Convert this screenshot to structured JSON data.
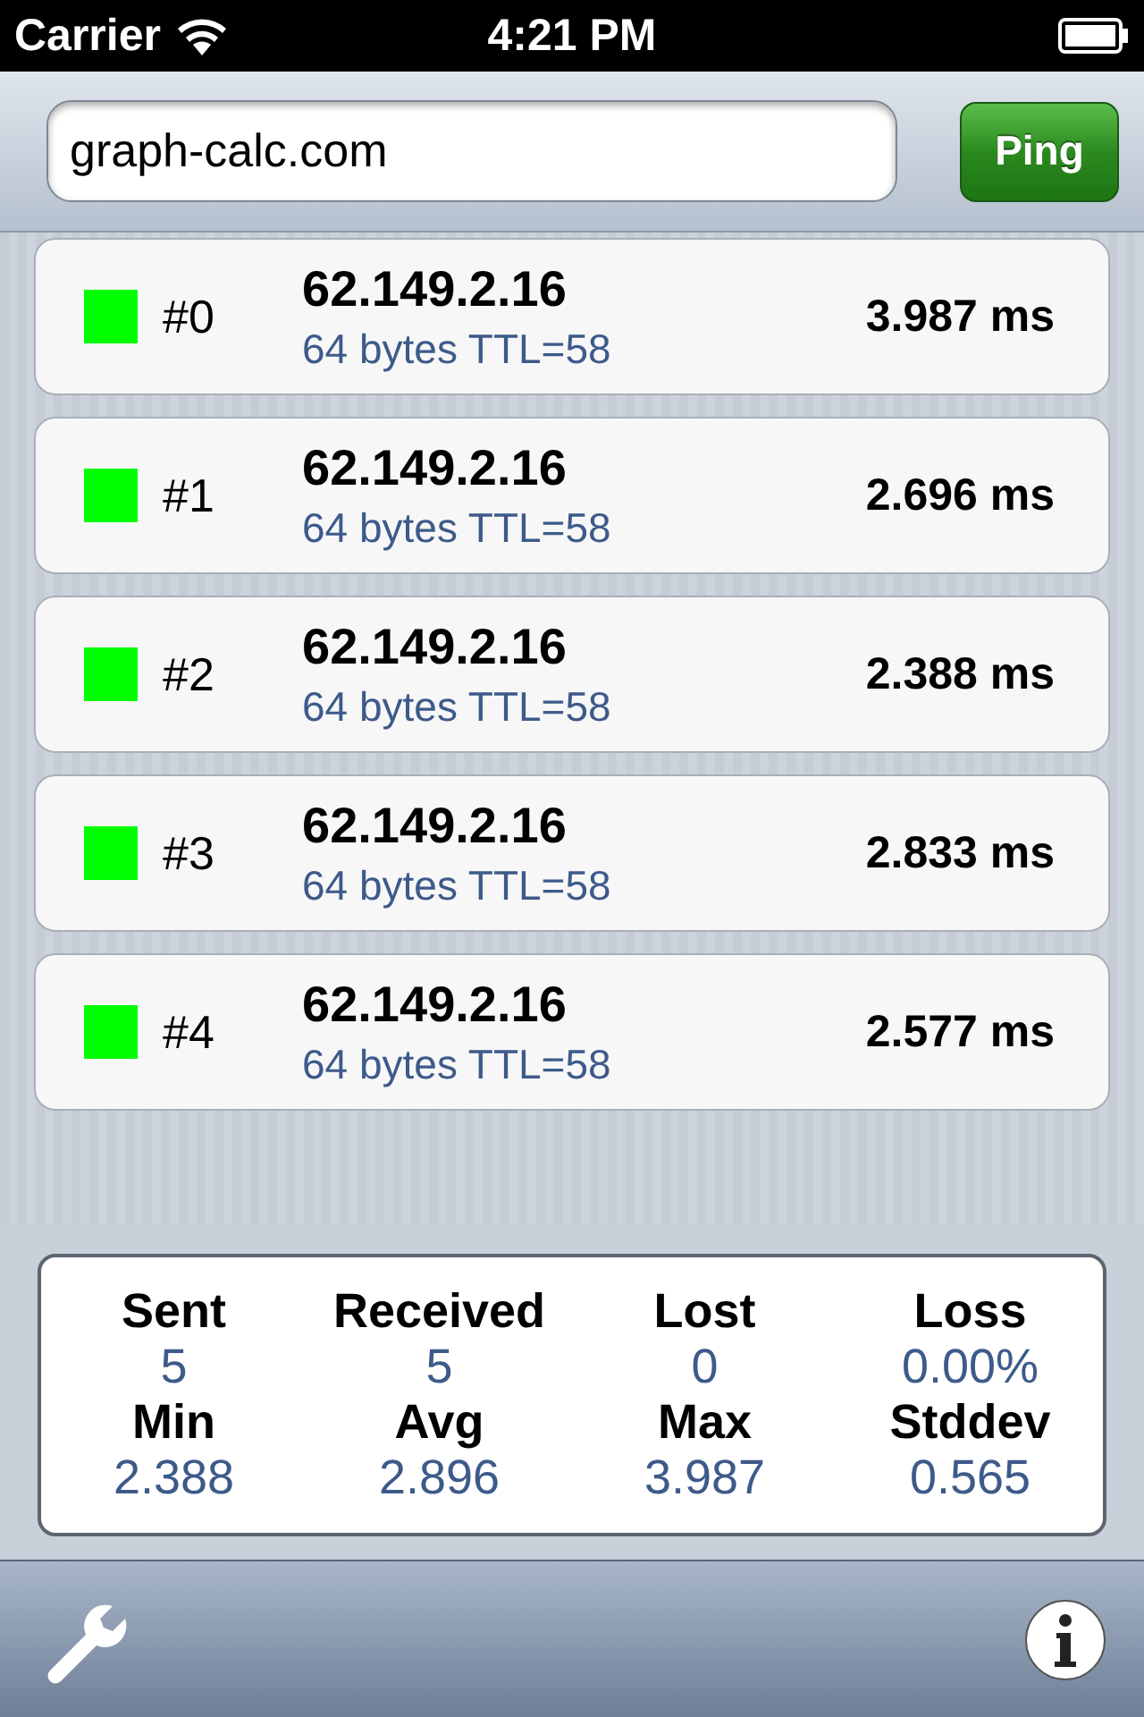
{
  "status_bar": {
    "carrier": "Carrier",
    "time": "4:21 PM"
  },
  "toolbar": {
    "host_field": {
      "value": "graph-calc.com"
    },
    "ping_button": "Ping"
  },
  "replies": [
    {
      "color": "#00ff00",
      "index": "#0",
      "address": "62.149.2.16",
      "detail": "64 bytes TTL=58",
      "time": "3.987 ms"
    },
    {
      "color": "#00ff00",
      "index": "#1",
      "address": "62.149.2.16",
      "detail": "64 bytes TTL=58",
      "time": "2.696 ms"
    },
    {
      "color": "#00ff00",
      "index": "#2",
      "address": "62.149.2.16",
      "detail": "64 bytes TTL=58",
      "time": "2.388 ms"
    },
    {
      "color": "#00ff00",
      "index": "#3",
      "address": "62.149.2.16",
      "detail": "64 bytes TTL=58",
      "time": "2.833 ms"
    },
    {
      "color": "#00ff00",
      "index": "#4",
      "address": "62.149.2.16",
      "detail": "64 bytes TTL=58",
      "time": "2.577 ms"
    }
  ],
  "stats": [
    {
      "label": "Sent",
      "value": "5"
    },
    {
      "label": "Received",
      "value": "5"
    },
    {
      "label": "Lost",
      "value": "0"
    },
    {
      "label": "Loss",
      "value": "0.00%"
    },
    {
      "label": "Min",
      "value": "2.388"
    },
    {
      "label": "Avg",
      "value": "2.896"
    },
    {
      "label": "Max",
      "value": "3.987"
    },
    {
      "label": "Stddev",
      "value": "0.565"
    }
  ]
}
